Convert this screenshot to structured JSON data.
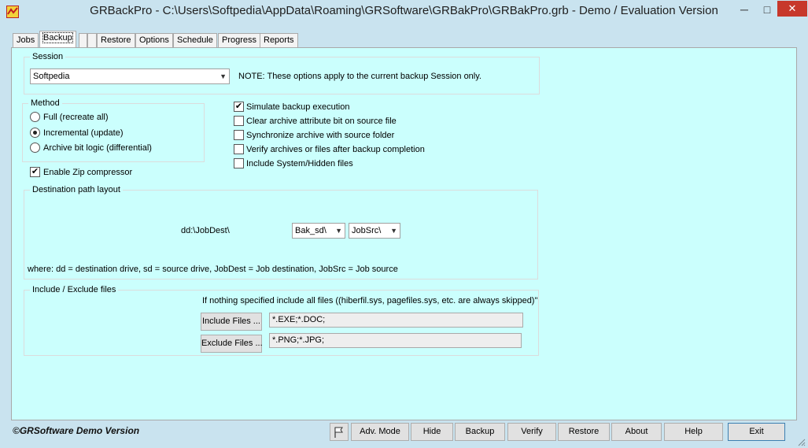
{
  "window": {
    "title": "GRBackPro - C:\\Users\\Softpedia\\AppData\\Roaming\\GRSoftware\\GRBakPro\\GRBakPro.grb - Demo / Evaluation Version",
    "minimize": "─",
    "maximize": "□",
    "close": "✕"
  },
  "tabs": [
    "Jobs",
    "Backup",
    "",
    "Restore",
    "Options",
    "Schedule",
    "Progress",
    "Reports"
  ],
  "active_tab": "Backup",
  "session": {
    "label": "Session",
    "selected": "Softpedia",
    "note": "NOTE: These options apply to the current backup Session only."
  },
  "method": {
    "label": "Method",
    "options": [
      "Full (recreate all)",
      "Incremental (update)",
      "Archive bit logic (differential)"
    ],
    "selected": "Incremental (update)"
  },
  "zip": {
    "label": "Enable Zip compressor",
    "checked": true
  },
  "options": [
    {
      "label": "Simulate backup execution",
      "checked": true
    },
    {
      "label": "Clear archive attribute bit on source file",
      "checked": false
    },
    {
      "label": "Synchronize archive with source folder",
      "checked": false
    },
    {
      "label": "Verify archives or files after backup completion",
      "checked": false
    },
    {
      "label": "Include System/Hidden files",
      "checked": false
    }
  ],
  "destination": {
    "label": "Destination path layout",
    "prefix": "dd:\\JobDest\\",
    "select1": "Bak_sd\\",
    "select2": "JobSrc\\",
    "legend": "where: dd = destination drive, sd = source drive, JobDest = Job destination, JobSrc = Job source"
  },
  "include_exclude": {
    "label": "Include / Exclude files",
    "note": "If nothing specified include all files ((hiberfil.sys, pagefiles.sys, etc. are always skipped)\"",
    "include_button": "Include Files ...",
    "include_value": "*.EXE;*.DOC;",
    "exclude_button": "Exclude Files ...",
    "exclude_value": "*.PNG;*.JPG;"
  },
  "footer": {
    "copyright": "©GRSoftware Demo Version",
    "buttons": [
      "Adv. Mode",
      "Hide",
      "Backup",
      "Verify",
      "Restore",
      "About",
      "Help",
      "Exit"
    ]
  }
}
